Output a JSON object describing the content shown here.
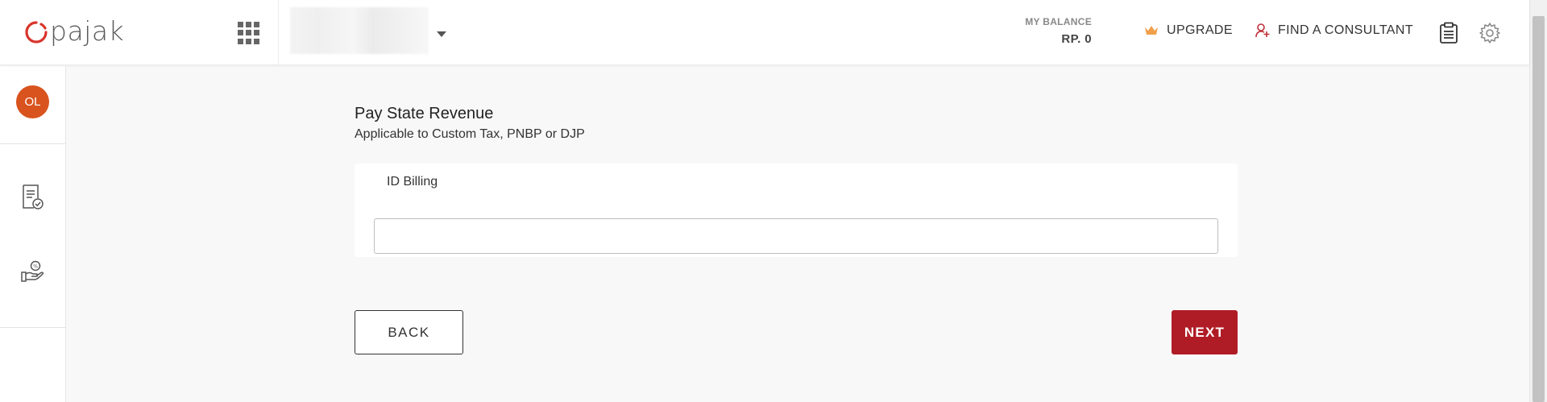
{
  "header": {
    "logo_text": "pajak",
    "balance_label": "MY BALANCE",
    "balance_value": "RP. 0",
    "upgrade_label": "UPGRADE",
    "consultant_label": "FIND A CONSULTANT"
  },
  "sidebar": {
    "avatar_initials": "OL"
  },
  "main": {
    "title": "Pay State Revenue",
    "subtitle": "Applicable to Custom Tax, PNBP or DJP",
    "field_label": "ID Billing",
    "field_value": "",
    "back_label": "BACK",
    "next_label": "NEXT"
  },
  "colors": {
    "brand_red": "#b01c26",
    "avatar_orange": "#d9531e",
    "crown_orange": "#f0a04b"
  },
  "icons": [
    "logo-mark-icon",
    "apps-grid-icon",
    "chevron-down-icon",
    "crown-icon",
    "consultant-icon",
    "clipboard-icon",
    "gear-icon",
    "document-check-icon",
    "hand-coin-icon"
  ]
}
